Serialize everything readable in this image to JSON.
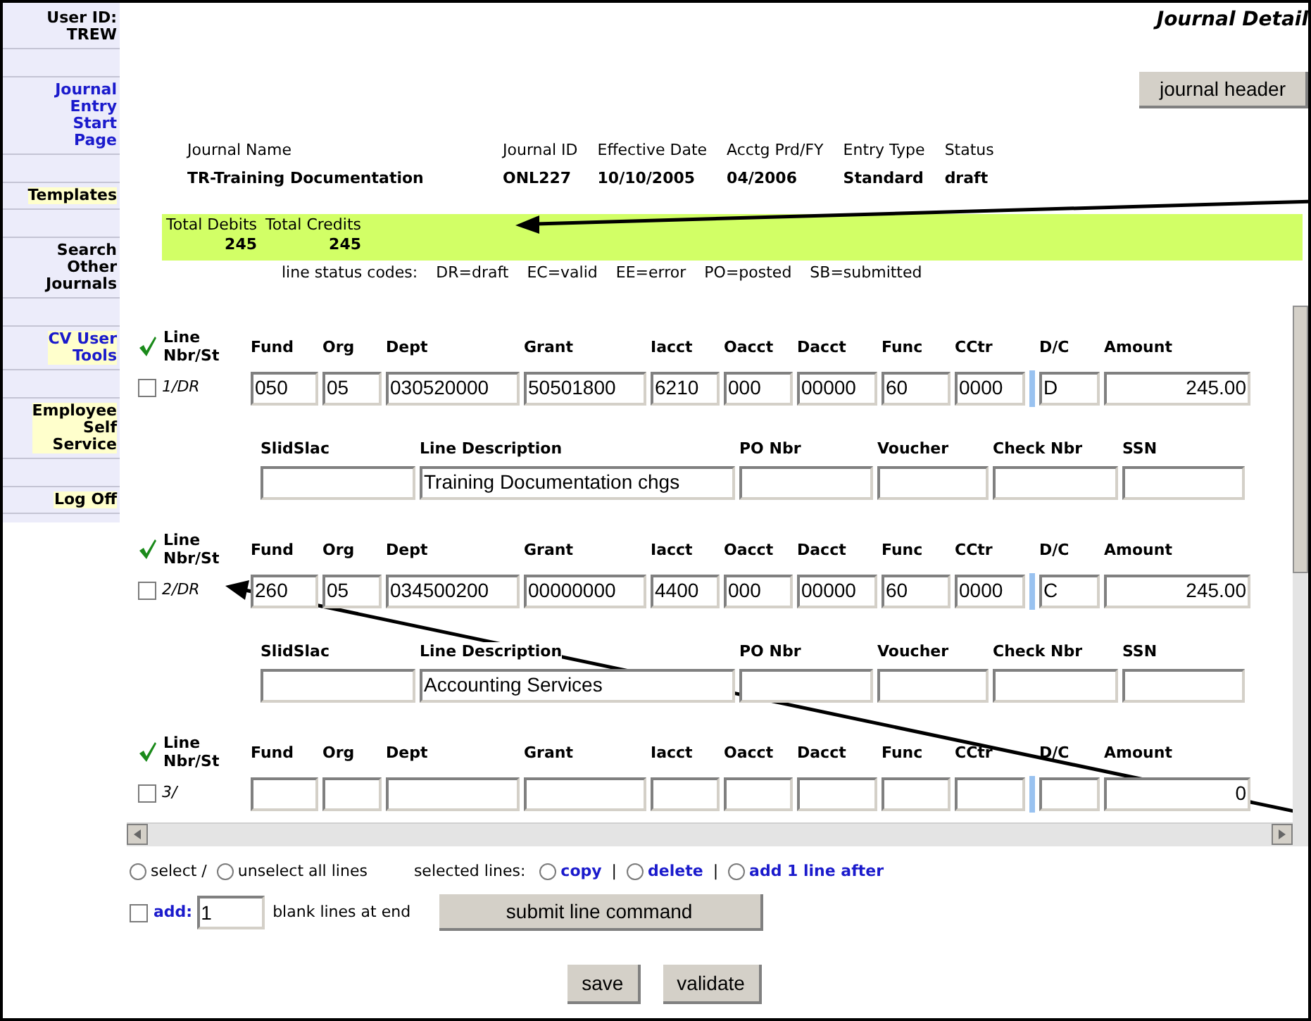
{
  "sidebar": {
    "items": [
      {
        "lines": [
          "User ID:",
          "TREW"
        ],
        "link": false,
        "highlighted": false
      },
      {
        "lines": [
          "Journal",
          "Entry",
          "Start",
          "Page"
        ],
        "link": true,
        "highlighted": false
      },
      {
        "lines": [
          "Templates"
        ],
        "link": false,
        "highlighted": true
      },
      {
        "lines": [
          "Search",
          "Other",
          "Journals"
        ],
        "link": false,
        "highlighted": false
      },
      {
        "lines": [
          "CV User",
          "Tools"
        ],
        "link": true,
        "highlighted": true
      },
      {
        "lines": [
          "Employee",
          "Self",
          "Service"
        ],
        "link": false,
        "highlighted": true
      },
      {
        "lines": [
          "Log Off"
        ],
        "link": false,
        "highlighted": true
      }
    ]
  },
  "page_title": "Journal Detail",
  "header_button": "journal header",
  "journal_info": [
    {
      "label": "Journal Name",
      "value": "TR-Training Documentation"
    },
    {
      "label": "Journal ID",
      "value": "ONL227"
    },
    {
      "label": "Effective Date",
      "value": "10/10/2005"
    },
    {
      "label": "Acctg Prd/FY",
      "value": "04/2006"
    },
    {
      "label": "Entry Type",
      "value": "Standard"
    },
    {
      "label": "Status",
      "value": "draft"
    }
  ],
  "totals": [
    {
      "label": "Total Debits",
      "value": "245"
    },
    {
      "label": "Total Credits",
      "value": "245"
    }
  ],
  "status_codes": {
    "label": "line status codes:",
    "codes": [
      "DR=draft",
      "EC=valid",
      "EE=error",
      "PO=posted",
      "SB=submitted"
    ]
  },
  "lines": [
    {
      "nbr_header": [
        "Line",
        "Nbr/St"
      ],
      "checked": false,
      "number": "1/DR",
      "columns": [
        {
          "header": "Fund",
          "value": "050"
        },
        {
          "header": "Org",
          "value": "05"
        },
        {
          "header": "Dept",
          "value": "030520000"
        },
        {
          "header": "Grant",
          "value": "50501800"
        },
        {
          "header": "Iacct",
          "value": "6210"
        },
        {
          "header": "Oacct",
          "value": "000"
        },
        {
          "header": "Dacct",
          "value": "00000"
        },
        {
          "header": "Func",
          "value": "60"
        },
        {
          "header": "CCtr",
          "value": "0000"
        },
        {
          "header": "D/C",
          "value": "D"
        },
        {
          "header": "Amount",
          "value": "245.00"
        }
      ],
      "details": [
        {
          "header": "SlidSlac"
        },
        {
          "header": "Line Description",
          "value": "Training Documentation chgs"
        },
        {
          "header": "PO Nbr"
        },
        {
          "header": "Voucher"
        },
        {
          "header": "Check Nbr"
        },
        {
          "header": "SSN"
        }
      ]
    },
    {
      "nbr_header": [
        "Line",
        "Nbr/St"
      ],
      "checked": false,
      "number": "2/DR",
      "columns": [
        {
          "header": "Fund",
          "value": "260"
        },
        {
          "header": "Org",
          "value": "05"
        },
        {
          "header": "Dept",
          "value": "034500200"
        },
        {
          "header": "Grant",
          "value": "00000000"
        },
        {
          "header": "Iacct",
          "value": "4400"
        },
        {
          "header": "Oacct",
          "value": "000"
        },
        {
          "header": "Dacct",
          "value": "00000"
        },
        {
          "header": "Func",
          "value": "60"
        },
        {
          "header": "CCtr",
          "value": "0000"
        },
        {
          "header": "D/C",
          "value": "C"
        },
        {
          "header": "Amount",
          "value": "245.00"
        }
      ],
      "details": [
        {
          "header": "SlidSlac"
        },
        {
          "header": "Line Description",
          "value": "Accounting Services"
        },
        {
          "header": "PO Nbr"
        },
        {
          "header": "Voucher"
        },
        {
          "header": "Check Nbr"
        },
        {
          "header": "SSN"
        }
      ]
    },
    {
      "nbr_header": [
        "Line",
        "Nbr/St"
      ],
      "checked": false,
      "number": "3/",
      "columns": [
        {
          "header": "Fund"
        },
        {
          "header": "Org"
        },
        {
          "header": "Dept"
        },
        {
          "header": "Grant"
        },
        {
          "header": "Iacct"
        },
        {
          "header": "Oacct"
        },
        {
          "header": "Dacct"
        },
        {
          "header": "Func"
        },
        {
          "header": "CCtr"
        },
        {
          "header": "D/C"
        },
        {
          "header": "Amount",
          "value": "0"
        }
      ]
    }
  ],
  "line_commands": {
    "select_options": [
      {
        "label": "select /",
        "selected": false
      },
      {
        "label": "unselect all lines",
        "selected": false
      }
    ],
    "selected_label": "selected lines:",
    "actions": [
      {
        "label": "copy",
        "selected": false,
        "separator": "|"
      },
      {
        "label": "delete",
        "selected": false,
        "separator": "|"
      },
      {
        "label": "add 1 line after",
        "selected": false
      }
    ]
  },
  "add_lines": {
    "checked": false,
    "label": "add:",
    "value": "1",
    "suffix": "blank lines at end"
  },
  "submit_button": "submit line command",
  "buttons": [
    "save",
    "validate"
  ]
}
